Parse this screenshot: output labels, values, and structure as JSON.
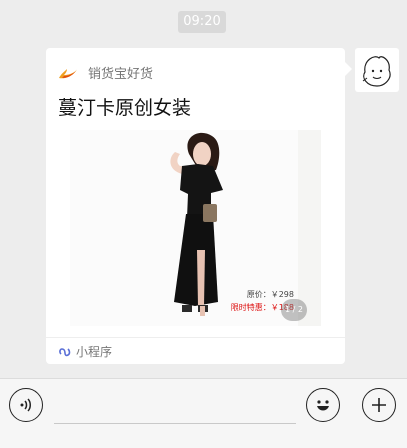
{
  "timestamp": "09:20",
  "message": {
    "app_name": "销货宝好货",
    "title": "蔓汀卡原创女装",
    "price_original": "原价：￥298",
    "price_sale": "限时特惠：￥188",
    "page_indicator": "1 / 2",
    "footer_label": "小程序"
  },
  "colors": {
    "background": "#ededed",
    "sale_price": "#dd1111",
    "miniprogram_icon": "#5a6fd6"
  },
  "icons": {
    "app_logo": "flame-logo-icon",
    "miniprogram": "miniprogram-icon",
    "voice": "voice-icon",
    "emoji": "emoji-icon",
    "plus": "plus-icon"
  }
}
